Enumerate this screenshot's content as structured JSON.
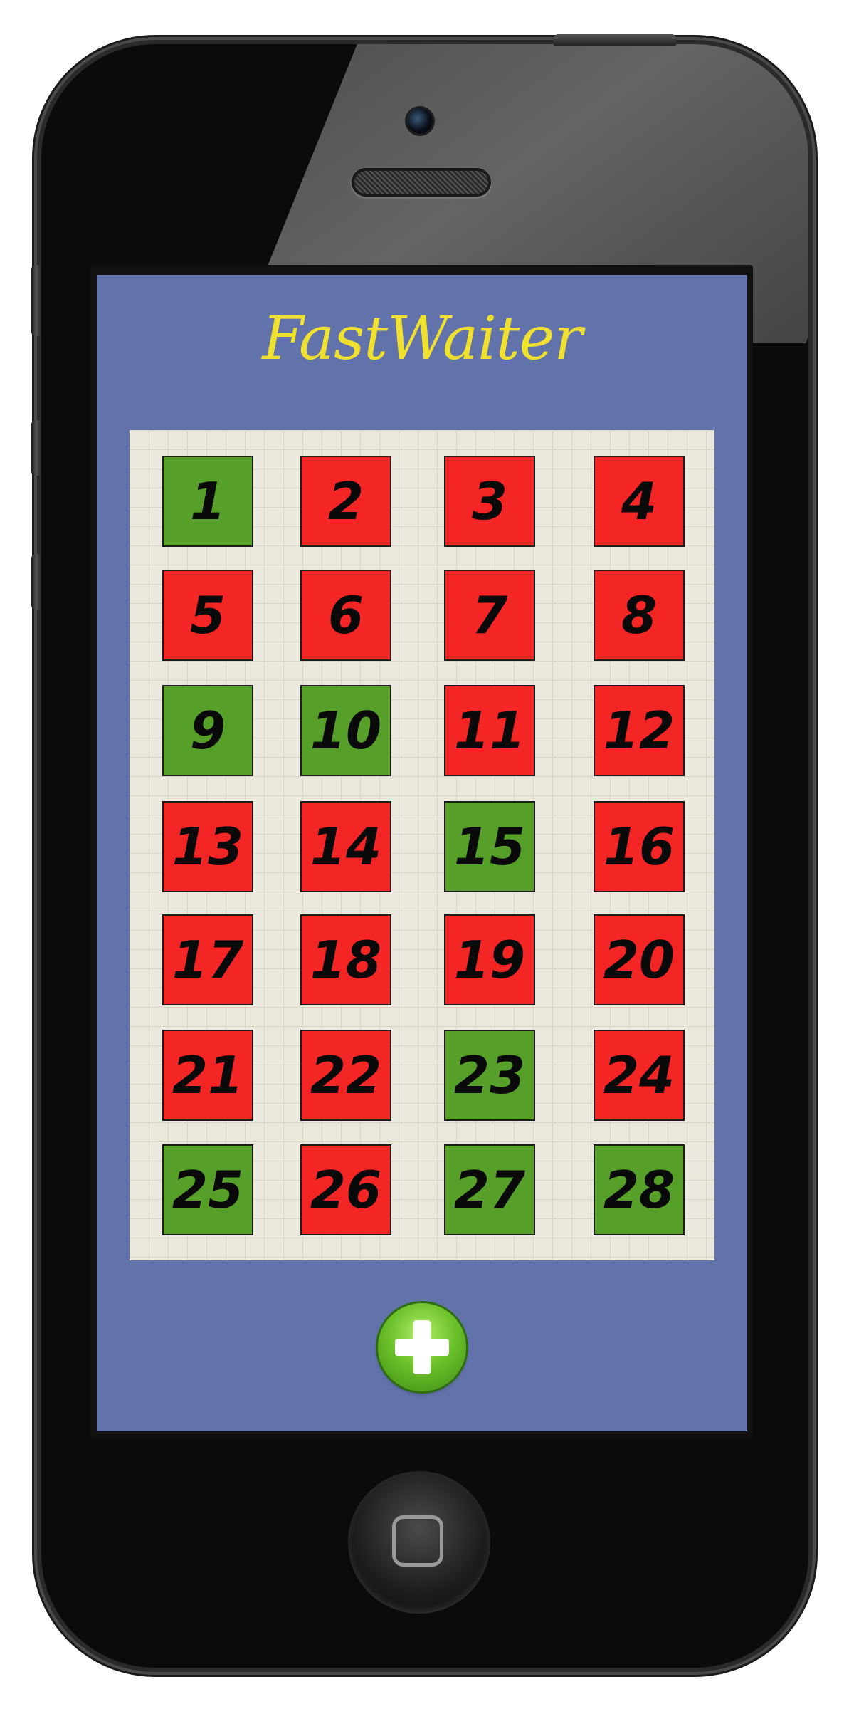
{
  "app": {
    "title": "FastWaiter"
  },
  "colors": {
    "background": "#6272aa",
    "title": "#f0e030",
    "free": "#56a02a",
    "busy": "#f32525"
  },
  "tables": [
    {
      "number": "1",
      "status": "free"
    },
    {
      "number": "2",
      "status": "busy"
    },
    {
      "number": "3",
      "status": "busy"
    },
    {
      "number": "4",
      "status": "busy"
    },
    {
      "number": "5",
      "status": "busy"
    },
    {
      "number": "6",
      "status": "busy"
    },
    {
      "number": "7",
      "status": "busy"
    },
    {
      "number": "8",
      "status": "busy"
    },
    {
      "number": "9",
      "status": "free"
    },
    {
      "number": "10",
      "status": "free"
    },
    {
      "number": "11",
      "status": "busy"
    },
    {
      "number": "12",
      "status": "busy"
    },
    {
      "number": "13",
      "status": "busy"
    },
    {
      "number": "14",
      "status": "busy"
    },
    {
      "number": "15",
      "status": "free"
    },
    {
      "number": "16",
      "status": "busy"
    },
    {
      "number": "17",
      "status": "busy"
    },
    {
      "number": "18",
      "status": "busy"
    },
    {
      "number": "19",
      "status": "busy"
    },
    {
      "number": "20",
      "status": "busy"
    },
    {
      "number": "21",
      "status": "busy"
    },
    {
      "number": "22",
      "status": "busy"
    },
    {
      "number": "23",
      "status": "free"
    },
    {
      "number": "24",
      "status": "busy"
    },
    {
      "number": "25",
      "status": "free"
    },
    {
      "number": "26",
      "status": "busy"
    },
    {
      "number": "27",
      "status": "free"
    },
    {
      "number": "28",
      "status": "free"
    }
  ],
  "add_button": {
    "icon": "plus-icon"
  },
  "device": {
    "home_icon": "home-square-icon"
  }
}
